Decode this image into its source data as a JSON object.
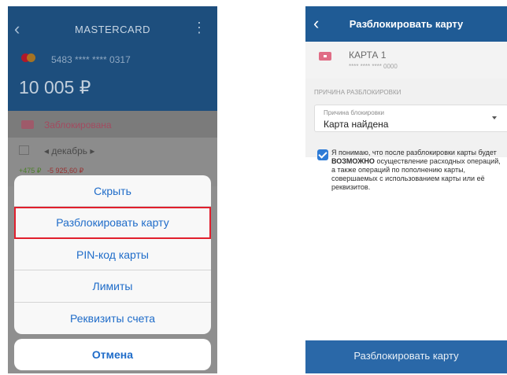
{
  "left_screen": {
    "header": {
      "title": "MASTERCARD",
      "back_glyph": "‹",
      "more_glyph": "⋮"
    },
    "card": {
      "number": "5483 **** **** 0317",
      "balance": "10 005 ₽",
      "brand_colors": [
        "#e4001b",
        "#f5a200"
      ]
    },
    "status": {
      "label": "Заблокирована"
    },
    "month": {
      "label": "◂ декабрь ▸",
      "income": "+475 ₽",
      "expense": "-5 925,60 ₽"
    },
    "action_sheet": {
      "items": [
        "Скрыть",
        "Разблокировать карту",
        "PIN-код карты",
        "Лимиты",
        "Реквизиты счета"
      ],
      "highlighted_index": 1,
      "cancel_label": "Отмена"
    }
  },
  "right_screen": {
    "header": {
      "title": "Разблокировать карту",
      "back_glyph": "‹"
    },
    "card": {
      "name": "КАРТА 1",
      "number": "**** **** **** 0000"
    },
    "section_title": "ПРИЧИНА РАЗБЛОКИРОВКИ",
    "reason_select": {
      "label": "Причина блокировки",
      "value": "Карта найдена"
    },
    "consent": {
      "checked": true,
      "text_before": "Я понимаю, что после разблокировки карты будет ",
      "text_bold": "ВОЗМОЖНО",
      "text_after": " осуществление расходных операций, а также операций по пополнению карты, совершаемых с использованием карты или её реквизитов."
    },
    "submit_label": "Разблокировать карту"
  },
  "colors": {
    "accent": "#1f6cc9",
    "header_blue": "#1f5b95",
    "highlight": "#e11f2d",
    "check_blue": "#2d7bd6"
  }
}
